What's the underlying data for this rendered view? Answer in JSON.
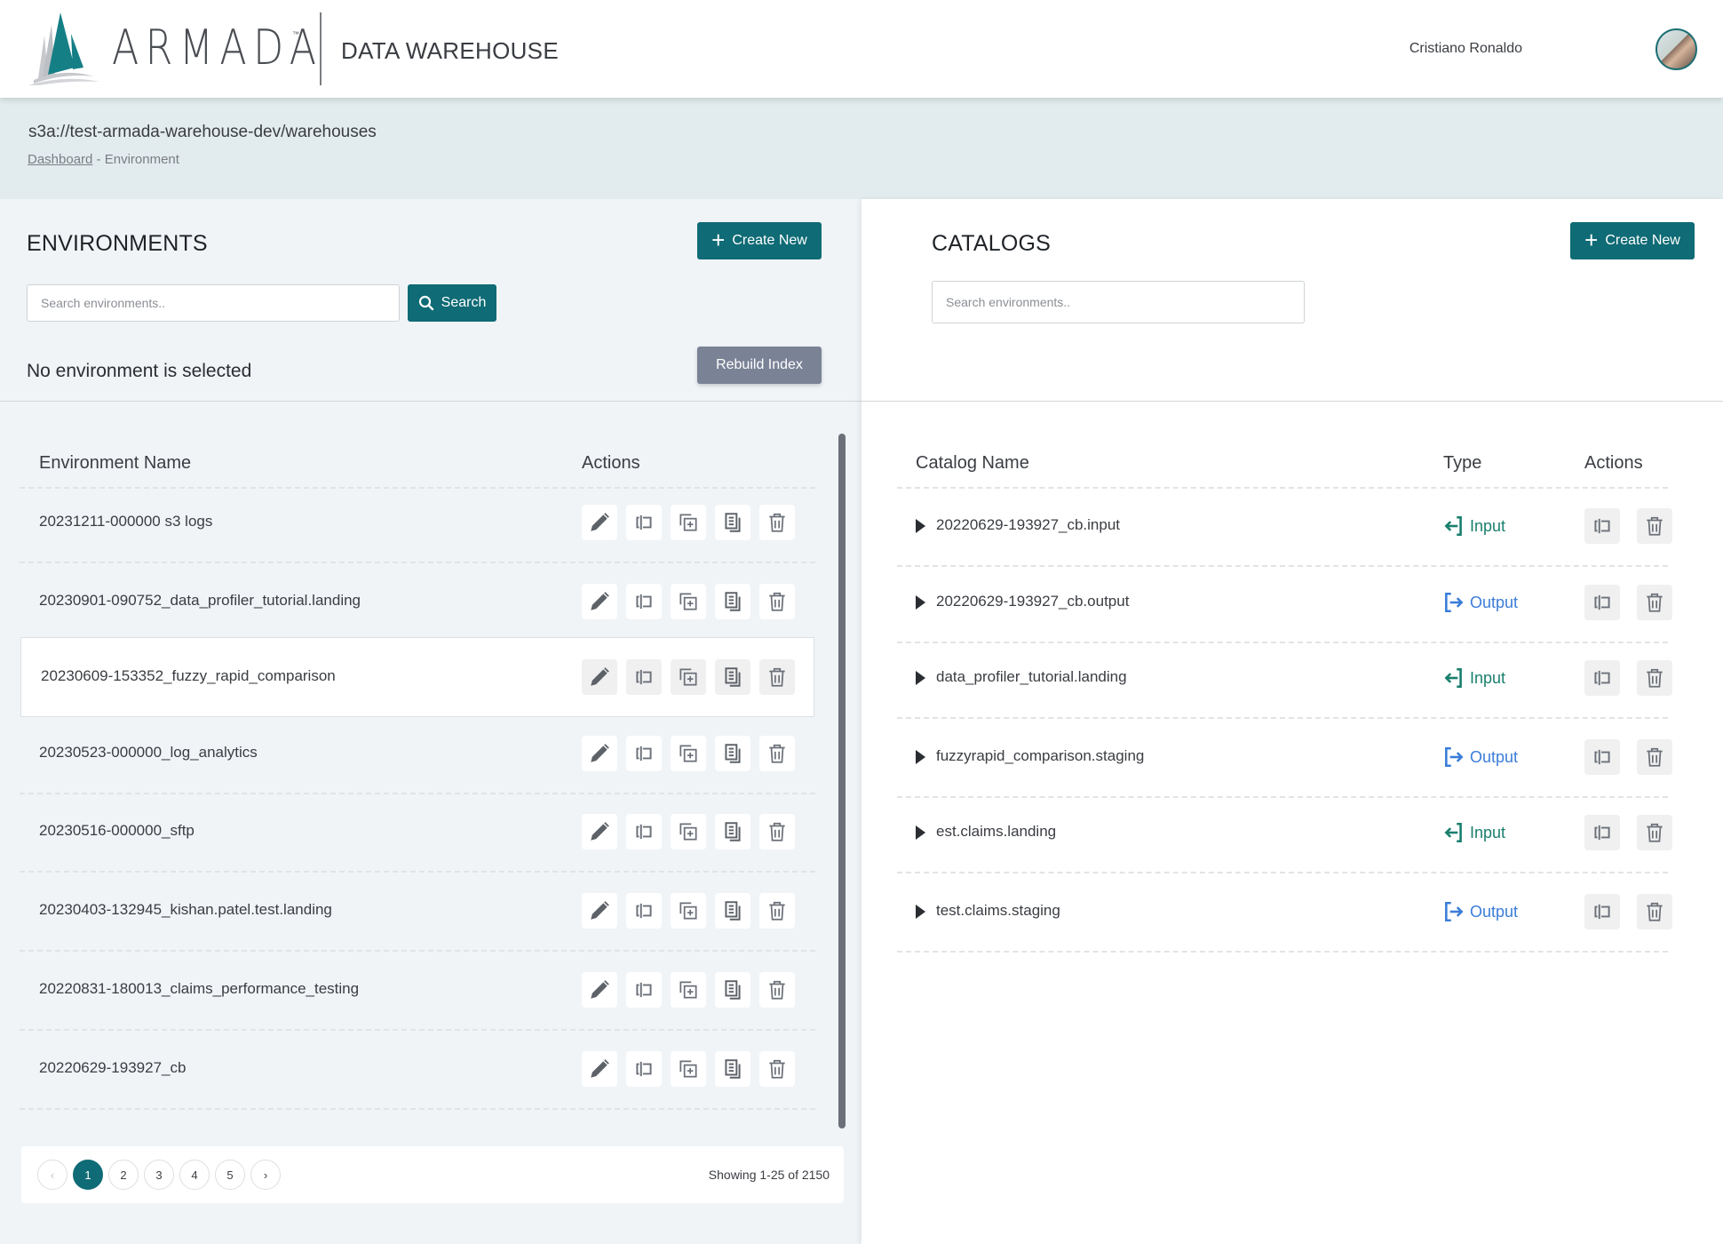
{
  "header": {
    "brand": "ARMADA",
    "trademark": "™",
    "app_title": "DATA WAREHOUSE",
    "user_name": "Cristiano Ronaldo"
  },
  "location": {
    "path": "s3a://test-armada-warehouse-dev/warehouses",
    "breadcrumb_link": "Dashboard",
    "breadcrumb_current": " - Environment"
  },
  "environments": {
    "title": "ENVIRONMENTS",
    "create_label": "Create New",
    "search_placeholder": "Search environments..",
    "search_value": "",
    "search_button": "Search",
    "status": "No environment is selected",
    "rebuild_label": "Rebuild Index",
    "columns": [
      "Environment Name",
      "Actions"
    ],
    "rows": [
      {
        "name": "20231211-000000 s3 logs"
      },
      {
        "name": "20230901-090752_data_profiler_tutorial.landing"
      },
      {
        "name": "20230609-153352_fuzzy_rapid_comparison",
        "highlighted": true
      },
      {
        "name": "20230523-000000_log_analytics"
      },
      {
        "name": "20230516-000000_sftp"
      },
      {
        "name": "20230403-132945_kishan.patel.test.landing"
      },
      {
        "name": "20220831-180013_claims_performance_testing"
      },
      {
        "name": "20220629-193927_cb"
      }
    ],
    "row_actions": [
      "edit-icon",
      "rename-icon",
      "duplicate-icon",
      "copy-icon",
      "trash-icon"
    ],
    "pagination": {
      "prev": "‹",
      "pages": [
        "1",
        "2",
        "3",
        "4",
        "5"
      ],
      "current": "1",
      "next": "›",
      "summary": "Showing 1-25 of 2150"
    }
  },
  "catalogs": {
    "title": "CATALOGS",
    "create_label": "Create New",
    "search_placeholder": "Search environments..",
    "search_value": "",
    "columns": [
      "Catalog Name",
      "Type",
      "Actions"
    ],
    "rows": [
      {
        "name": "20220629-193927_cb.input",
        "type": "Input"
      },
      {
        "name": "20220629-193927_cb.output",
        "type": "Output"
      },
      {
        "name": "data_profiler_tutorial.landing",
        "type": "Input"
      },
      {
        "name": "fuzzyrapid_comparison.staging",
        "type": "Output"
      },
      {
        "name": "est.claims.landing",
        "type": "Input"
      },
      {
        "name": "test.claims.staging",
        "type": "Output"
      }
    ],
    "row_actions": [
      "rename-icon",
      "trash-icon"
    ]
  },
  "colors": {
    "primary": "#0f6b75",
    "input_type": "#1a7f6e",
    "output_type": "#3b7dd8",
    "rebuild": "#7a8396",
    "breadcrumb_band": "#e2ecee",
    "left_pane": "#f0f4f7"
  }
}
